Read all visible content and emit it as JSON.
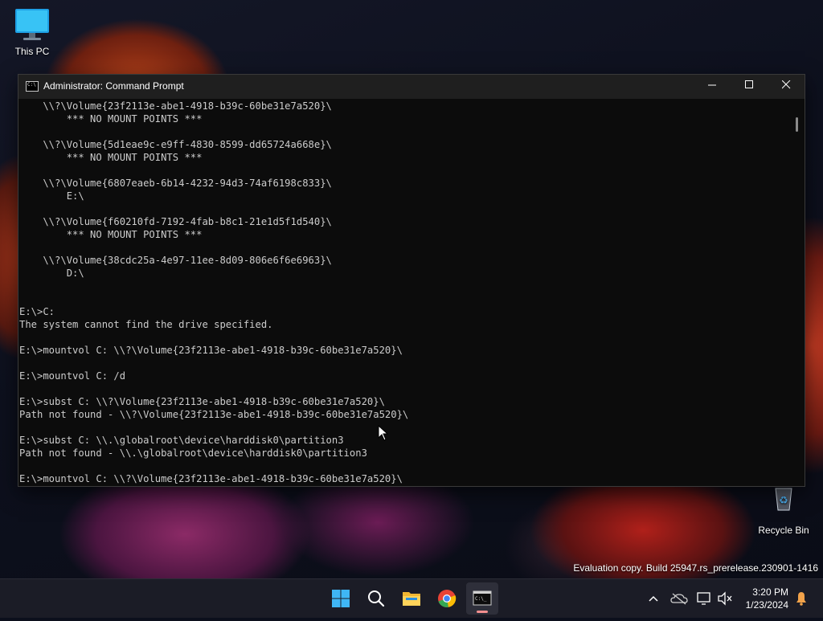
{
  "desktop": {
    "icons": [
      {
        "label": "This PC",
        "icon": "monitor-icon"
      },
      {
        "label": "Recycle Bin",
        "icon": "recycle-bin-icon"
      }
    ],
    "watermark": "Evaluation copy. Build 25947.rs_prerelease.230901-1416"
  },
  "window": {
    "title": "Administrator: Command Prompt",
    "buttons": {
      "minimize": "—",
      "maximize": "☐",
      "close": "✕"
    },
    "console_lines": [
      "    \\\\?\\Volume{23f2113e-abe1-4918-b39c-60be31e7a520}\\",
      "        *** NO MOUNT POINTS ***",
      "",
      "    \\\\?\\Volume{5d1eae9c-e9ff-4830-8599-dd65724a668e}\\",
      "        *** NO MOUNT POINTS ***",
      "",
      "    \\\\?\\Volume{6807eaeb-6b14-4232-94d3-74af6198c833}\\",
      "        E:\\",
      "",
      "    \\\\?\\Volume{f60210fd-7192-4fab-b8c1-21e1d5f1d540}\\",
      "        *** NO MOUNT POINTS ***",
      "",
      "    \\\\?\\Volume{38cdc25a-4e97-11ee-8d09-806e6f6e6963}\\",
      "        D:\\",
      "",
      "",
      "E:\\>C:",
      "The system cannot find the drive specified.",
      "",
      "E:\\>mountvol C: \\\\?\\Volume{23f2113e-abe1-4918-b39c-60be31e7a520}\\",
      "",
      "E:\\>mountvol C: /d",
      "",
      "E:\\>subst C: \\\\?\\Volume{23f2113e-abe1-4918-b39c-60be31e7a520}\\",
      "Path not found - \\\\?\\Volume{23f2113e-abe1-4918-b39c-60be31e7a520}\\",
      "",
      "E:\\>subst C: \\\\.\\globalroot\\device\\harddisk0\\partition3",
      "Path not found - \\\\.\\globalroot\\device\\harddisk0\\partition3",
      "",
      "E:\\>mountvol C: \\\\?\\Volume{23f2113e-abe1-4918-b39c-60be31e7a520}\\"
    ]
  },
  "taskbar": {
    "apps": [
      {
        "name": "start",
        "icon": "windows-start-icon"
      },
      {
        "name": "search",
        "icon": "search-icon"
      },
      {
        "name": "file-explorer",
        "icon": "folder-icon"
      },
      {
        "name": "chrome",
        "icon": "chrome-icon"
      },
      {
        "name": "command-prompt",
        "icon": "terminal-icon",
        "active": true
      }
    ],
    "clock": {
      "time": "3:20 PM",
      "date": "1/23/2024"
    },
    "colors": {
      "active_indicator": "#f48f8f",
      "notification": "#f1a24a"
    }
  }
}
